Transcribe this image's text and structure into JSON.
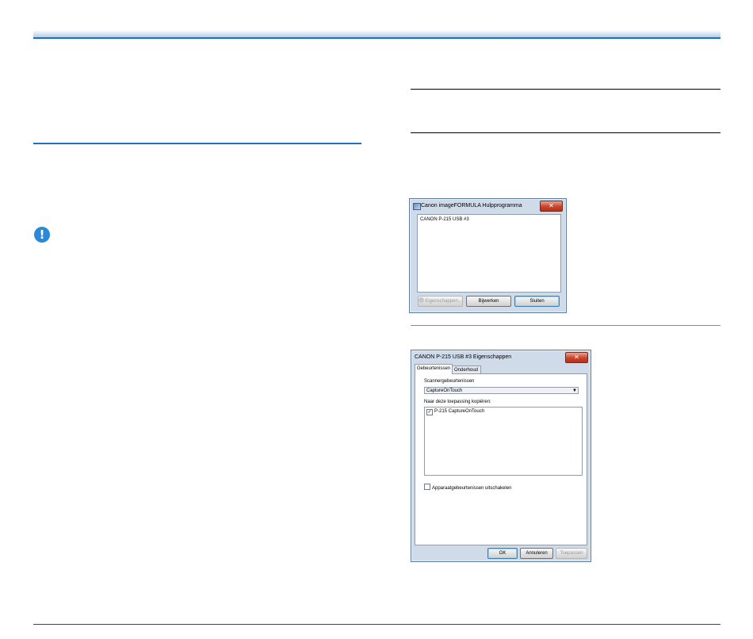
{
  "dialog_1": {
    "title": "Canon imageFORMULA Hulpprogramma",
    "close_glyph": "✕",
    "list_items": [
      "CANON P-215 USB #3"
    ],
    "buttons": {
      "properties": "Eigenschappen...",
      "edit": "Bijwerken",
      "close": "Sluiten"
    }
  },
  "dialog_2": {
    "title": "CANON P-215 USB #3 Eigenschappen",
    "close_glyph": "✕",
    "tabs": [
      "Gebeurtenissen",
      "Onderhoud"
    ],
    "scanner_events_label": "Scannergebeurtenissen",
    "scanner_event_selected": "CaptureOnTouch",
    "copy_to_label": "Naar deze toepassing kopiëren:",
    "applications": [
      {
        "label": "P-215 CaptureOnTouch",
        "checked": true
      }
    ],
    "disable_events_label": "Apparaatgebeurtenissen uitschakelen",
    "disable_events_checked": false,
    "buttons": {
      "ok": "OK",
      "cancel": "Annuleren",
      "apply": "Toepassen"
    }
  },
  "colors": {
    "accent_blue": "#1f6ec7",
    "important_icon": "#2b8ad8",
    "dialog_frame": "#cfdbe9"
  },
  "icons": {
    "important": "!"
  }
}
